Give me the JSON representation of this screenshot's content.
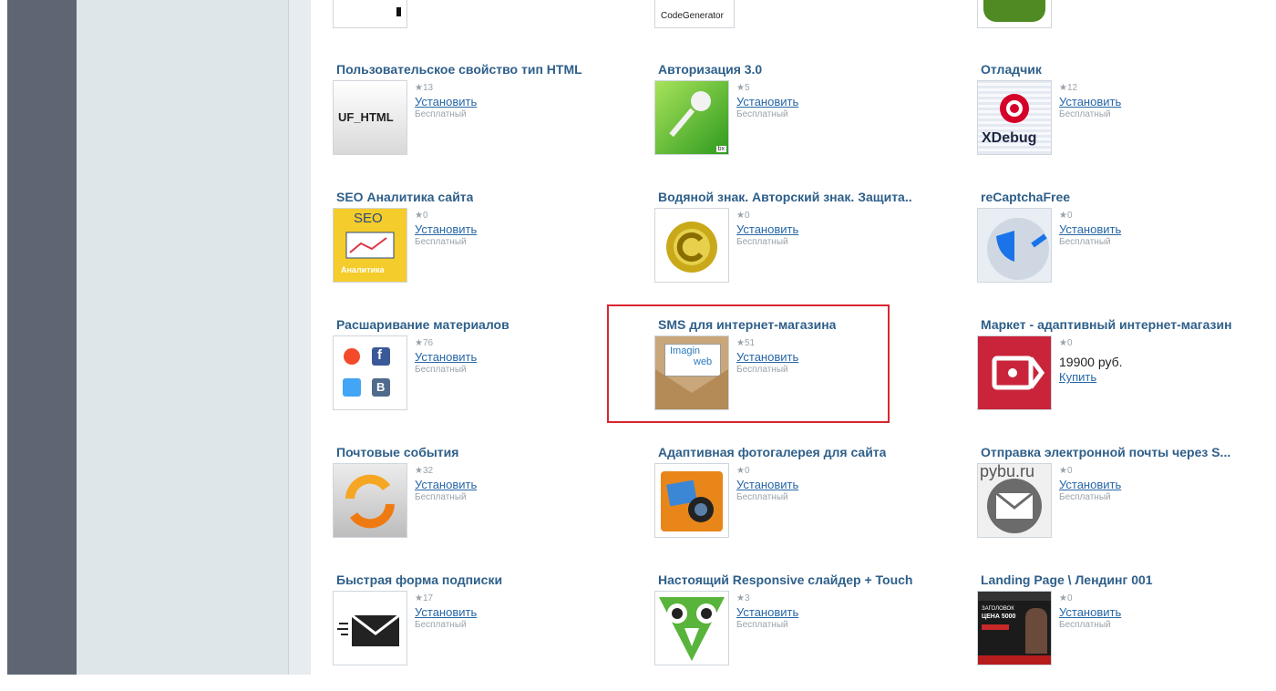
{
  "top_row": {
    "codegen_label": "CodeGenerator"
  },
  "cards": [
    {
      "title": "Пользовательское свойство тип HTML",
      "rating": "13",
      "action": "Установить",
      "price_type": "Бесплатный",
      "thumb_text": "UF_HTML"
    },
    {
      "title": "Авторизация 3.0",
      "rating": "5",
      "action": "Установить",
      "price_type": "Бесплатный",
      "thumb_text": "bx"
    },
    {
      "title": "Отладчик",
      "rating": "12",
      "action": "Установить",
      "price_type": "Бесплатный",
      "thumb_text": "XDebug"
    },
    {
      "title": "SEO Аналитика сайта",
      "rating": "0",
      "action": "Установить",
      "price_type": "Бесплатный",
      "thumb_text_top": "SEO",
      "thumb_text_bottom": "Аналитика"
    },
    {
      "title": "Водяной знак. Авторский знак. Защита..",
      "rating": "0",
      "action": "Установить",
      "price_type": "Бесплатный"
    },
    {
      "title": "reCaptchaFree",
      "rating": "0",
      "action": "Установить",
      "price_type": "Бесплатный"
    },
    {
      "title": "Расшаривание материалов",
      "rating": "76",
      "action": "Установить",
      "price_type": "Бесплатный",
      "thumb_text": "f",
      "thumb_text2": "B"
    },
    {
      "title": "SMS для интернет-магазина",
      "rating": "51",
      "action": "Установить",
      "price_type": "Бесплатный",
      "thumb_text": "Imagin",
      "thumb_text2": "web"
    },
    {
      "title": "Маркет - адаптивный интернет-магазин",
      "rating": "0",
      "price": "19900 руб.",
      "action": "Купить"
    },
    {
      "title": "Почтовые события",
      "rating": "32",
      "action": "Установить",
      "price_type": "Бесплатный"
    },
    {
      "title": "Адаптивная фотогалерея для сайта",
      "rating": "0",
      "action": "Установить",
      "price_type": "Бесплатный"
    },
    {
      "title": "Отправка электронной почты через S...",
      "rating": "0",
      "action": "Установить",
      "price_type": "Бесплатный",
      "thumb_text": "pybu.ru"
    },
    {
      "title": "Быстрая форма подписки",
      "rating": "17",
      "action": "Установить",
      "price_type": "Бесплатный"
    },
    {
      "title": "Настоящий Responsive слайдер + Touch",
      "rating": "3",
      "action": "Установить",
      "price_type": "Бесплатный"
    },
    {
      "title": "Landing Page \\ Лендинг 001",
      "rating": "0",
      "action": "Установить",
      "price_type": "Бесплатный",
      "thumb_text": "ЗАГОЛОВОК",
      "thumb_text2": "ЦЕНА 5000"
    }
  ],
  "star_glyph": "★",
  "colors": {
    "title": "#2e5f8a",
    "link": "#2767a7",
    "highlight": "#d9262f",
    "rail": "#5f6673",
    "sidebar": "#dfe6ea"
  }
}
